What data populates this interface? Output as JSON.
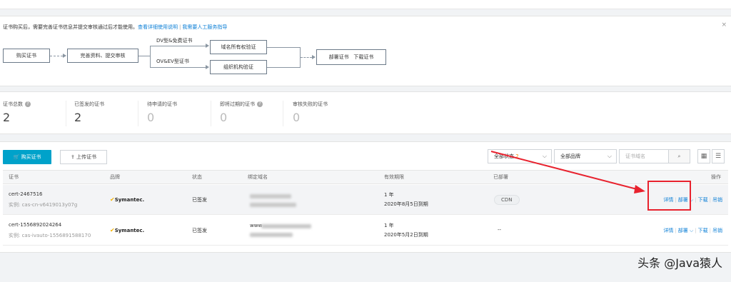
{
  "notice": {
    "text": "证书购买后，需要完善证书信息并提交审核通过后才能使用。",
    "link1": "查看详细使用说明",
    "link2": "我需要人工服务指导"
  },
  "flow": {
    "buy": "购买证书",
    "complete": "完善资料、提交审核",
    "dv_label": "DV型&免费证书",
    "ov_label": "OV&EV型证书",
    "domain_verify": "域名所有权验证",
    "org_verify": "组织机构验证",
    "deploy": "部署证书",
    "download": "下载证书"
  },
  "stats": [
    {
      "label": "证书总数",
      "value": "2",
      "help": true
    },
    {
      "label": "已签发的证书",
      "value": "2",
      "help": false
    },
    {
      "label": "待申请的证书",
      "value": "0",
      "help": false
    },
    {
      "label": "即将过期的证书",
      "value": "0",
      "help": true
    },
    {
      "label": "审核失败的证书",
      "value": "0",
      "help": false
    }
  ],
  "toolbar": {
    "buy_label": "购买证书",
    "upload_label": "上传证书",
    "status_select": "全部状态",
    "status_count": "2",
    "brand_select": "全部品牌",
    "search_placeholder": "证书域名"
  },
  "table": {
    "headers": [
      "证书",
      "品牌",
      "状态",
      "绑定域名",
      "有效期限",
      "已部署",
      "操作"
    ],
    "rows": [
      {
        "name": "cert-2467516",
        "instance": "实例: cas-cn-v6419013y07g",
        "brand": "Symantec.",
        "status": "已签发",
        "validity": "1 年",
        "expire": "2020年8月5日到期",
        "deployed": "CDN",
        "actions": {
          "detail": "详情",
          "deploy": "部署",
          "download": "下载",
          "revoke": "吊销"
        }
      },
      {
        "name": "cert-1556892024264",
        "instance": "实例: cas-ivauto-1556891588170",
        "brand": "Symantec.",
        "status": "已签发",
        "domain_prefix": "www",
        "validity": "1 年",
        "expire": "2020年5月2日到期",
        "deployed": "--",
        "actions": {
          "detail": "详情",
          "deploy": "部署",
          "download": "下载",
          "revoke": "吊销"
        }
      }
    ]
  },
  "watermark": "头条 @Java猿人",
  "colors": {
    "primary": "#00a2ca",
    "link": "#0c7fd6",
    "annotation": "#e8222e"
  }
}
